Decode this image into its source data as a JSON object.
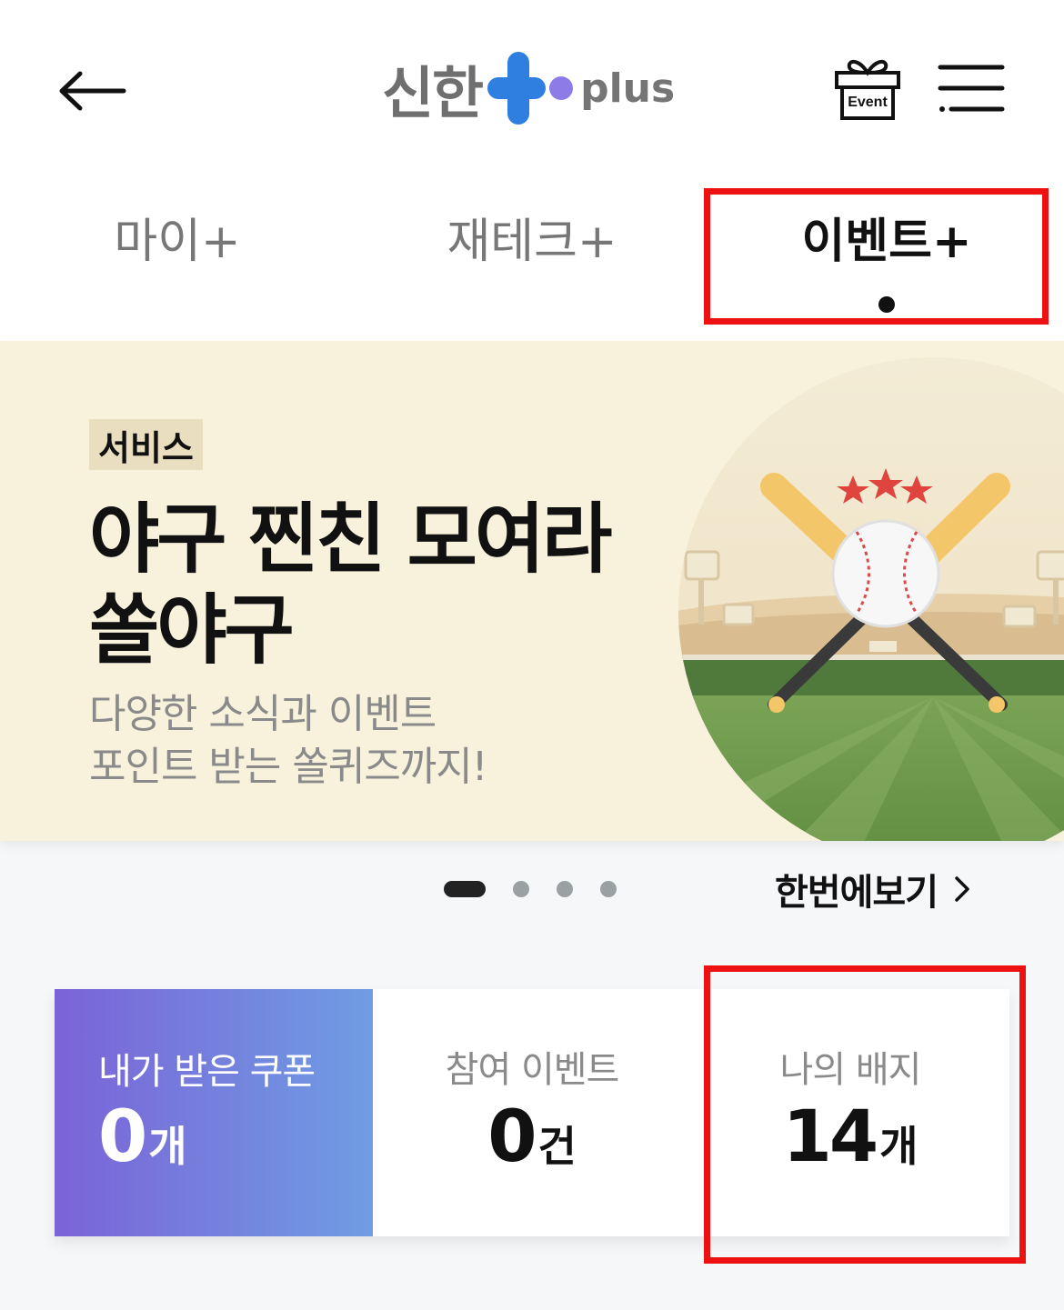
{
  "header": {
    "logo_ko": "신한",
    "logo_en": "plus",
    "event_icon_label": "Event",
    "icons": [
      "back-arrow-icon",
      "event-gift-icon",
      "menu-icon"
    ]
  },
  "tabs": [
    {
      "label": "마이+",
      "active": false
    },
    {
      "label": "재테크+",
      "active": false
    },
    {
      "label": "이벤트+",
      "active": true
    }
  ],
  "banner": {
    "badge": "서비스",
    "title_line1": "야구 찐친 모여라",
    "title_line2": "쏠야구",
    "sub_line1": "다양한 소식과 이벤트",
    "sub_line2": "포인트 받는 쏠퀴즈까지!"
  },
  "carousel": {
    "page_count": 4,
    "active_index": 0,
    "see_all_label": "한번에보기"
  },
  "stats": {
    "coupon": {
      "label": "내가 받은 쿠폰",
      "value": "0",
      "unit": "개"
    },
    "events": {
      "label": "참여 이벤트",
      "value": "0",
      "unit": "건"
    },
    "badges": {
      "label": "나의 배지",
      "value": "14",
      "unit": "개"
    }
  },
  "colors": {
    "highlight": "#ee1111",
    "brand_blue": "#2f7fe0",
    "brand_purple": "#8d7ce8",
    "banner_bg": "#f8f1dc",
    "coupon_gradient_start": "#7b63d8",
    "coupon_gradient_end": "#6f9de3"
  }
}
